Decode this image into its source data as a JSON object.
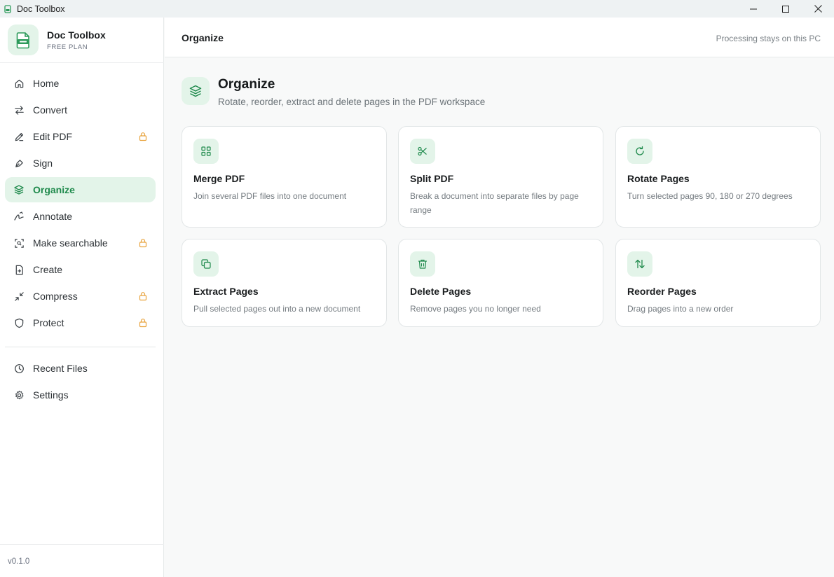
{
  "window": {
    "title": "Doc Toolbox"
  },
  "brand": {
    "name": "Doc Toolbox",
    "plan": "FREE PLAN"
  },
  "accent_color": "#1f8a4c",
  "accent_bg": "#e3f4e9",
  "lock_color": "#e8a33d",
  "sidebar": {
    "items": [
      {
        "label": "Home",
        "icon": "home-icon",
        "locked": false,
        "active": false
      },
      {
        "label": "Convert",
        "icon": "convert-arrows-icon",
        "locked": false,
        "active": false
      },
      {
        "label": "Edit PDF",
        "icon": "pencil-icon",
        "locked": true,
        "active": false
      },
      {
        "label": "Sign",
        "icon": "pen-nib-icon",
        "locked": false,
        "active": false
      },
      {
        "label": "Organize",
        "icon": "layers-icon",
        "locked": false,
        "active": true
      },
      {
        "label": "Annotate",
        "icon": "signature-icon",
        "locked": false,
        "active": false
      },
      {
        "label": "Make searchable",
        "icon": "scan-icon",
        "locked": true,
        "active": false
      },
      {
        "label": "Create",
        "icon": "file-plus-icon",
        "locked": false,
        "active": false
      },
      {
        "label": "Compress",
        "icon": "minimize-icon",
        "locked": true,
        "active": false
      },
      {
        "label": "Protect",
        "icon": "shield-icon",
        "locked": true,
        "active": false
      }
    ],
    "secondary": [
      {
        "label": "Recent Files",
        "icon": "clock-icon"
      },
      {
        "label": "Settings",
        "icon": "gear-icon"
      }
    ],
    "version": "v0.1.0"
  },
  "header": {
    "title": "Organize",
    "note": "Processing stays on this PC"
  },
  "page": {
    "title": "Organize",
    "subtitle": "Rotate, reorder, extract and delete pages in the PDF workspace"
  },
  "cards": [
    {
      "title": "Merge PDF",
      "desc": "Join several PDF files into one document",
      "icon": "merge-icon"
    },
    {
      "title": "Split PDF",
      "desc": "Break a document into separate files by page range",
      "icon": "scissors-icon"
    },
    {
      "title": "Rotate Pages",
      "desc": "Turn selected pages 90, 180 or 270 degrees",
      "icon": "rotate-icon"
    },
    {
      "title": "Extract Pages",
      "desc": "Pull selected pages out into a new document",
      "icon": "copy-icon"
    },
    {
      "title": "Delete Pages",
      "desc": "Remove pages you no longer need",
      "icon": "trash-icon"
    },
    {
      "title": "Reorder Pages",
      "desc": "Drag pages into a new order",
      "icon": "reorder-arrows-icon"
    }
  ]
}
